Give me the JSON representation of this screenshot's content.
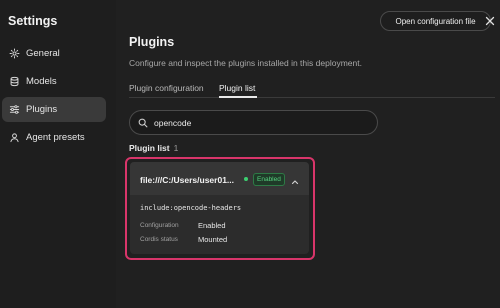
{
  "sidebar": {
    "title": "Settings",
    "items": [
      {
        "label": "General",
        "icon": "gear-icon"
      },
      {
        "label": "Models",
        "icon": "database-icon"
      },
      {
        "label": "Plugins",
        "icon": "sliders-icon",
        "active": true
      },
      {
        "label": "Agent presets",
        "icon": "agent-icon"
      }
    ]
  },
  "header": {
    "open_config_label": "Open configuration file",
    "close_icon": "close-icon"
  },
  "page": {
    "title": "Plugins",
    "description": "Configure and inspect the plugins installed in this deployment."
  },
  "tabs": [
    {
      "label": "Plugin configuration",
      "active": false
    },
    {
      "label": "Plugin list",
      "active": true
    }
  ],
  "search": {
    "value": "opencode",
    "icon": "search-icon"
  },
  "plugin_list": {
    "heading": "Plugin list",
    "count": "1",
    "items": [
      {
        "name": "file:///C:/Users/user01...",
        "status": "Enabled",
        "module": "include:opencode-headers",
        "fields": [
          {
            "key": "Configuration",
            "value": "Enabled"
          },
          {
            "key": "Cordis status",
            "value": "Mounted"
          }
        ]
      }
    ]
  },
  "colors": {
    "accent_highlight": "#d8356a",
    "status_green": "#55d07e",
    "background": "#202020"
  }
}
